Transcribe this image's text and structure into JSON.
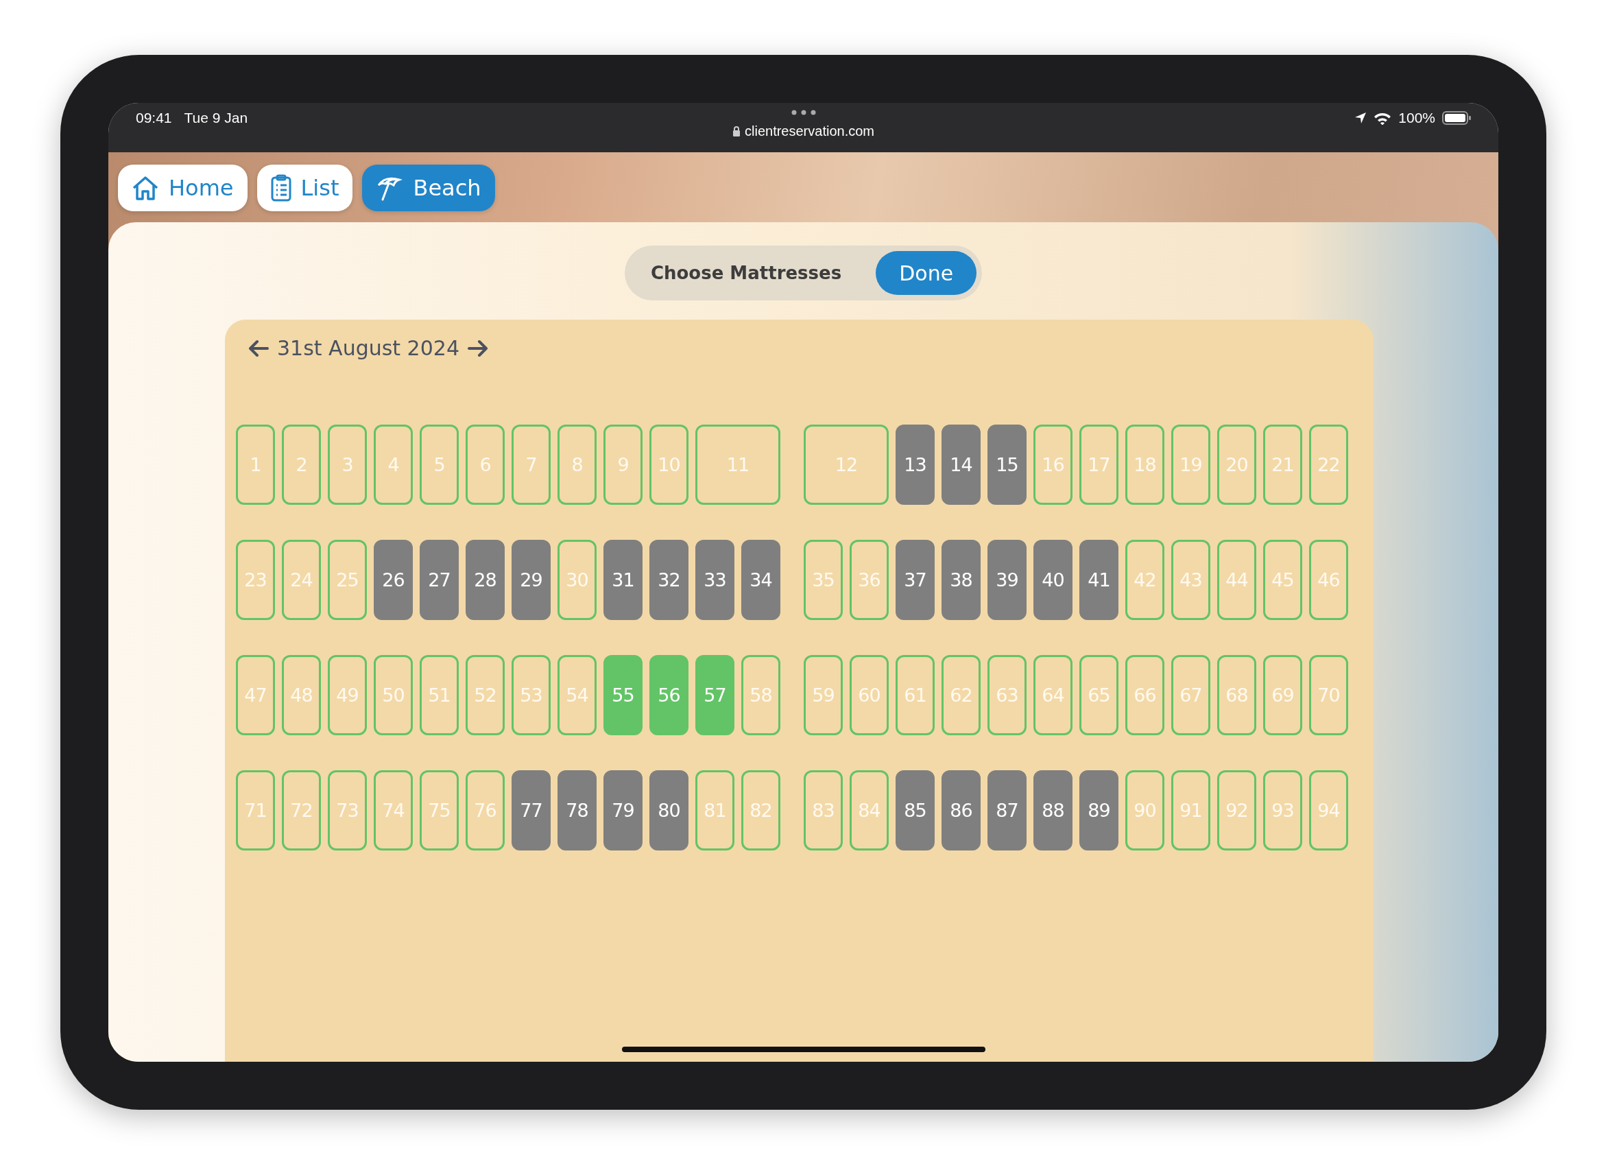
{
  "status_bar": {
    "time": "09:41",
    "date": "Tue 9 Jan",
    "url": "clientreservation.com",
    "battery": "100%"
  },
  "nav": [
    {
      "label": "Home",
      "selected": false
    },
    {
      "label": "List",
      "selected": false
    },
    {
      "label": "Beach",
      "selected": true
    }
  ],
  "header": {
    "title": "Choose Mattresses",
    "button": "Done"
  },
  "date": "31st August 2024",
  "rows": [
    {
      "groups": [
        [
          {
            "label": "1",
            "kind": "single",
            "occupied": false,
            "selected": false
          },
          {
            "label": "2",
            "kind": "single",
            "occupied": false,
            "selected": false
          },
          {
            "label": "3",
            "kind": "single",
            "occupied": false,
            "selected": false
          },
          {
            "label": "4",
            "kind": "single",
            "occupied": false,
            "selected": false
          },
          {
            "label": "5",
            "kind": "single",
            "occupied": false,
            "selected": false
          },
          {
            "label": "6",
            "kind": "single",
            "occupied": false,
            "selected": false
          },
          {
            "label": "7",
            "kind": "single",
            "occupied": false,
            "selected": false
          },
          {
            "label": "8",
            "kind": "single",
            "occupied": false,
            "selected": false
          },
          {
            "label": "9",
            "kind": "single",
            "occupied": false,
            "selected": false
          },
          {
            "label": "10",
            "kind": "single",
            "occupied": false,
            "selected": false
          },
          {
            "label": "11",
            "kind": "double",
            "occupied": false,
            "selected": false
          }
        ],
        [
          {
            "label": "12",
            "kind": "double",
            "occupied": false,
            "selected": false
          },
          {
            "label": "13",
            "kind": "single",
            "occupied": true,
            "selected": false
          },
          {
            "label": "14",
            "kind": "single",
            "occupied": true,
            "selected": false
          },
          {
            "label": "15",
            "kind": "single",
            "occupied": true,
            "selected": false
          },
          {
            "label": "16",
            "kind": "single",
            "occupied": false,
            "selected": false
          },
          {
            "label": "17",
            "kind": "single",
            "occupied": false,
            "selected": false
          },
          {
            "label": "18",
            "kind": "single",
            "occupied": false,
            "selected": false
          },
          {
            "label": "19",
            "kind": "single",
            "occupied": false,
            "selected": false
          },
          {
            "label": "20",
            "kind": "single",
            "occupied": false,
            "selected": false
          },
          {
            "label": "21",
            "kind": "single",
            "occupied": false,
            "selected": false
          },
          {
            "label": "22",
            "kind": "single",
            "occupied": false,
            "selected": false
          }
        ]
      ]
    },
    {
      "groups": [
        [
          {
            "label": "23",
            "kind": "single",
            "occupied": false,
            "selected": false
          },
          {
            "label": "24",
            "kind": "single",
            "occupied": false,
            "selected": false
          },
          {
            "label": "25",
            "kind": "single",
            "occupied": false,
            "selected": false
          },
          {
            "label": "26",
            "kind": "single",
            "occupied": true,
            "selected": false
          },
          {
            "label": "27",
            "kind": "single",
            "occupied": true,
            "selected": false
          },
          {
            "label": "28",
            "kind": "single",
            "occupied": true,
            "selected": false
          },
          {
            "label": "29",
            "kind": "single",
            "occupied": true,
            "selected": false
          },
          {
            "label": "30",
            "kind": "single",
            "occupied": false,
            "selected": false
          },
          {
            "label": "31",
            "kind": "single",
            "occupied": true,
            "selected": false
          },
          {
            "label": "32",
            "kind": "single",
            "occupied": true,
            "selected": false
          },
          {
            "label": "33",
            "kind": "single",
            "occupied": true,
            "selected": false
          },
          {
            "label": "34",
            "kind": "single",
            "occupied": true,
            "selected": false
          }
        ],
        [
          {
            "label": "35",
            "kind": "single",
            "occupied": false,
            "selected": false
          },
          {
            "label": "36",
            "kind": "single",
            "occupied": false,
            "selected": false
          },
          {
            "label": "37",
            "kind": "single",
            "occupied": true,
            "selected": false
          },
          {
            "label": "38",
            "kind": "single",
            "occupied": true,
            "selected": false
          },
          {
            "label": "39",
            "kind": "single",
            "occupied": true,
            "selected": false
          },
          {
            "label": "40",
            "kind": "single",
            "occupied": true,
            "selected": false
          },
          {
            "label": "41",
            "kind": "single",
            "occupied": true,
            "selected": false
          },
          {
            "label": "42",
            "kind": "single",
            "occupied": false,
            "selected": false
          },
          {
            "label": "43",
            "kind": "single",
            "occupied": false,
            "selected": false
          },
          {
            "label": "44",
            "kind": "single",
            "occupied": false,
            "selected": false
          },
          {
            "label": "45",
            "kind": "single",
            "occupied": false,
            "selected": false
          },
          {
            "label": "46",
            "kind": "single",
            "occupied": false,
            "selected": false
          }
        ]
      ]
    },
    {
      "groups": [
        [
          {
            "label": "47",
            "kind": "single",
            "occupied": false,
            "selected": false
          },
          {
            "label": "48",
            "kind": "single",
            "occupied": false,
            "selected": false
          },
          {
            "label": "49",
            "kind": "single",
            "occupied": false,
            "selected": false
          },
          {
            "label": "50",
            "kind": "single",
            "occupied": false,
            "selected": false
          },
          {
            "label": "51",
            "kind": "single",
            "occupied": false,
            "selected": false
          },
          {
            "label": "52",
            "kind": "single",
            "occupied": false,
            "selected": false
          },
          {
            "label": "53",
            "kind": "single",
            "occupied": false,
            "selected": false
          },
          {
            "label": "54",
            "kind": "single",
            "occupied": false,
            "selected": false
          },
          {
            "label": "55",
            "kind": "single",
            "occupied": false,
            "selected": true
          },
          {
            "label": "56",
            "kind": "single",
            "occupied": false,
            "selected": true
          },
          {
            "label": "57",
            "kind": "single",
            "occupied": false,
            "selected": true
          },
          {
            "label": "58",
            "kind": "single",
            "occupied": false,
            "selected": false
          }
        ],
        [
          {
            "label": "59",
            "kind": "single",
            "occupied": false,
            "selected": false
          },
          {
            "label": "60",
            "kind": "single",
            "occupied": false,
            "selected": false
          },
          {
            "label": "61",
            "kind": "single",
            "occupied": false,
            "selected": false
          },
          {
            "label": "62",
            "kind": "single",
            "occupied": false,
            "selected": false
          },
          {
            "label": "63",
            "kind": "single",
            "occupied": false,
            "selected": false
          },
          {
            "label": "64",
            "kind": "single",
            "occupied": false,
            "selected": false
          },
          {
            "label": "65",
            "kind": "single",
            "occupied": false,
            "selected": false
          },
          {
            "label": "66",
            "kind": "single",
            "occupied": false,
            "selected": false
          },
          {
            "label": "67",
            "kind": "single",
            "occupied": false,
            "selected": false
          },
          {
            "label": "68",
            "kind": "single",
            "occupied": false,
            "selected": false
          },
          {
            "label": "69",
            "kind": "single",
            "occupied": false,
            "selected": false
          },
          {
            "label": "70",
            "kind": "single",
            "occupied": false,
            "selected": false
          }
        ]
      ]
    },
    {
      "groups": [
        [
          {
            "label": "71",
            "kind": "single",
            "occupied": false,
            "selected": false
          },
          {
            "label": "72",
            "kind": "single",
            "occupied": false,
            "selected": false
          },
          {
            "label": "73",
            "kind": "single",
            "occupied": false,
            "selected": false
          },
          {
            "label": "74",
            "kind": "single",
            "occupied": false,
            "selected": false
          },
          {
            "label": "75",
            "kind": "single",
            "occupied": false,
            "selected": false
          },
          {
            "label": "76",
            "kind": "single",
            "occupied": false,
            "selected": false
          },
          {
            "label": "77",
            "kind": "single",
            "occupied": true,
            "selected": false
          },
          {
            "label": "78",
            "kind": "single",
            "occupied": true,
            "selected": false
          },
          {
            "label": "79",
            "kind": "single",
            "occupied": true,
            "selected": false
          },
          {
            "label": "80",
            "kind": "single",
            "occupied": true,
            "selected": false
          },
          {
            "label": "81",
            "kind": "single",
            "occupied": false,
            "selected": false
          },
          {
            "label": "82",
            "kind": "single",
            "occupied": false,
            "selected": false
          }
        ],
        [
          {
            "label": "83",
            "kind": "single",
            "occupied": false,
            "selected": false
          },
          {
            "label": "84",
            "kind": "single",
            "occupied": false,
            "selected": false
          },
          {
            "label": "85",
            "kind": "single",
            "occupied": true,
            "selected": false
          },
          {
            "label": "86",
            "kind": "single",
            "occupied": true,
            "selected": false
          },
          {
            "label": "87",
            "kind": "single",
            "occupied": true,
            "selected": false
          },
          {
            "label": "88",
            "kind": "single",
            "occupied": true,
            "selected": false
          },
          {
            "label": "89",
            "kind": "single",
            "occupied": true,
            "selected": false
          },
          {
            "label": "90",
            "kind": "single",
            "occupied": false,
            "selected": false
          },
          {
            "label": "91",
            "kind": "single",
            "occupied": false,
            "selected": false
          },
          {
            "label": "92",
            "kind": "single",
            "occupied": false,
            "selected": false
          },
          {
            "label": "93",
            "kind": "single",
            "occupied": false,
            "selected": false
          },
          {
            "label": "94",
            "kind": "single",
            "occupied": false,
            "selected": false
          }
        ]
      ]
    }
  ]
}
